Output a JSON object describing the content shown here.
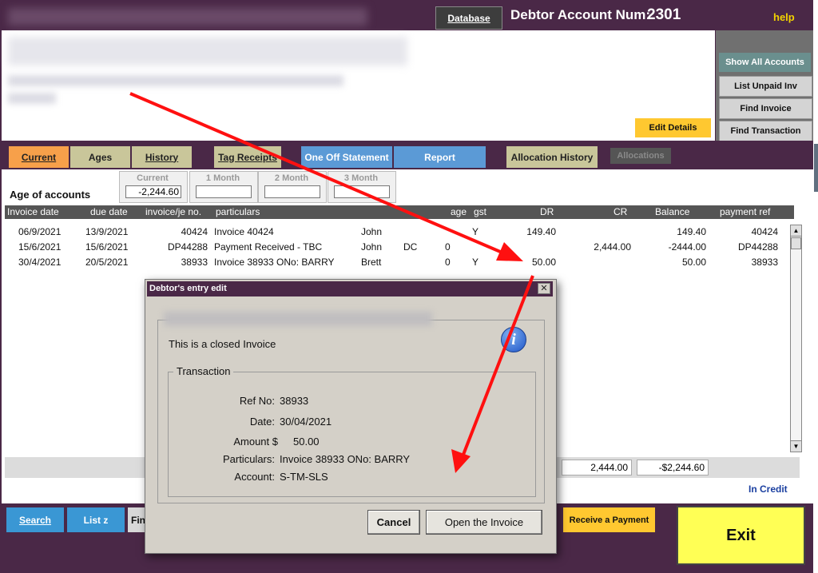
{
  "titlebar": {
    "database_label": "Database",
    "account_label": "Debtor Account Num:",
    "account_num": "2301",
    "help_label": "help"
  },
  "customer": {
    "edit_details_label": "Edit Details"
  },
  "right_buttons": {
    "show_all": "Show All Accounts",
    "list_unpaid": "List Unpaid Inv",
    "find_invoice": "Find Invoice",
    "find_transaction": "Find Transaction"
  },
  "tabs": {
    "current": "Current",
    "ages": "Ages",
    "history": "History",
    "tag_receipts": "Tag Receipts",
    "one_off_statement": "One Off Statement",
    "report": "Report",
    "allocation_history": "Allocation History",
    "allocations": "Allocations"
  },
  "ages": {
    "title": "Age of accounts",
    "current_label": "Current",
    "current_value": "-2,244.60",
    "month1_label": "1 Month",
    "month2_label": "2 Month",
    "month3_label": "3 Month"
  },
  "table": {
    "headers": [
      "Invoice date",
      "due date",
      "invoice/je no.",
      "particulars",
      "age",
      "gst",
      "DR",
      "CR",
      "Balance",
      "payment ref"
    ],
    "rows": [
      {
        "invoice_date": "06/9/2021",
        "due_date": "13/9/2021",
        "invno": "40424",
        "particulars": "Invoice 40424",
        "who": "John",
        "code": "",
        "age": "",
        "gst": "Y",
        "dr": "149.40",
        "cr": "",
        "balance": "149.40",
        "payref": "40424"
      },
      {
        "invoice_date": "15/6/2021",
        "due_date": "15/6/2021",
        "invno": "DP44288",
        "particulars": "Payment Received - TBC",
        "who": "John",
        "code": "DC",
        "age": "0",
        "gst": "",
        "dr": "",
        "cr": "2,444.00",
        "balance": "-2444.00",
        "payref": "DP44288"
      },
      {
        "invoice_date": "30/4/2021",
        "due_date": "20/5/2021",
        "invno": "38933",
        "particulars": "Invoice 38933 ONo: BARRY",
        "who": "Brett",
        "code": "",
        "age": "0",
        "gst": "Y",
        "dr": "50.00",
        "cr": "",
        "balance": "50.00",
        "payref": "38933"
      }
    ]
  },
  "totals": {
    "cr_total": "2,444.00",
    "balance_total": "-$2,244.60",
    "status": "In Credit"
  },
  "bottom": {
    "search": "Search",
    "list_z": "List z",
    "fin": "Fin",
    "receive_payment": "Receive a Payment",
    "exit": "Exit"
  },
  "dialog": {
    "title": "Debtor's entry edit",
    "message": "This is a closed Invoice",
    "group_label": "Transaction",
    "ref_label": "Ref No:",
    "ref_value": "38933",
    "date_label": "Date:",
    "date_value": "30/04/2021",
    "amount_label": "Amount $",
    "amount_value": "50.00",
    "particulars_label": "Particulars:",
    "particulars_value": "Invoice 38933 ONo: BARRY",
    "account_label": "Account:",
    "account_value": "S-TM-SLS",
    "cancel": "Cancel",
    "open_invoice": "Open the Invoice",
    "close_glyph": "✕",
    "info_glyph": "i"
  },
  "colors": {
    "annotation_arrow": "#ff1010",
    "window_bg": "#4a2847"
  }
}
